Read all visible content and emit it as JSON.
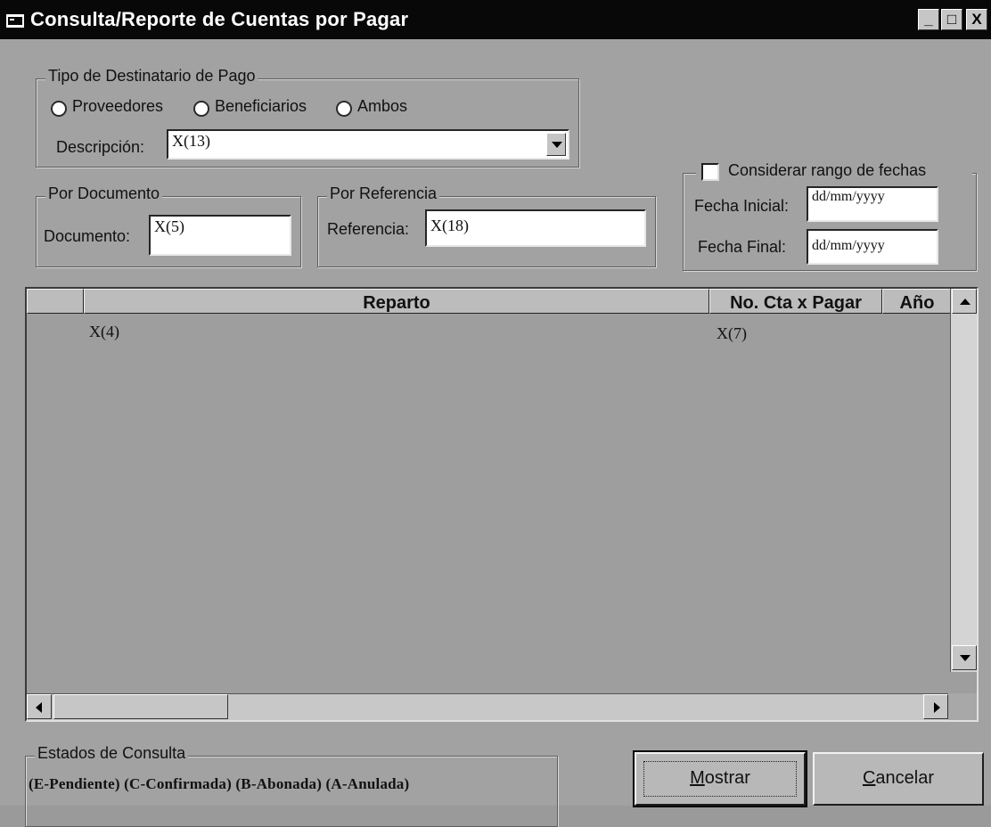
{
  "window": {
    "title": "Consulta/Reporte de Cuentas por Pagar",
    "controls": [
      "_",
      "□",
      "X"
    ]
  },
  "tipo_destinatario": {
    "legend": "Tipo de Destinatario de Pago",
    "options": [
      "Proveedores",
      "Beneficiarios",
      "Ambos"
    ],
    "descripcion_label": "Descripción:",
    "descripcion_value": "X(13)"
  },
  "fechas": {
    "checkbox_label": "Considerar rango de fechas",
    "checked": false,
    "fecha_inicial_label": "Fecha Inicial:",
    "fecha_inicial_value": "dd/mm/yyyy",
    "fecha_final_label": "Fecha Final:",
    "fecha_final_value": "dd/mm/yyyy"
  },
  "por_documento": {
    "legend": "Por Documento",
    "label": "Documento:",
    "value": "X(5)"
  },
  "por_referencia": {
    "legend": "Por Referencia",
    "label": "Referencia:",
    "value": "X(18)"
  },
  "grid": {
    "columns": [
      "",
      "Reparto",
      "No. Cta x Pagar",
      "Año"
    ],
    "rows": [
      {
        "reparto": "X(4)",
        "no_cta": "X(7)",
        "anio": ""
      }
    ]
  },
  "estados": {
    "legend": "Estados de Consulta",
    "text": "(E-Pendiente)  (C-Confirmada)  (B-Abonada)  (A-Anulada)"
  },
  "buttons": {
    "mostrar": {
      "mnemonic": "M",
      "rest": "ostrar"
    },
    "cancelar": {
      "mnemonic": "C",
      "rest": "ancelar"
    }
  },
  "icons": {
    "app": "app-window-icon",
    "dropdown": "chevron-down-icon",
    "minimize": "minimize-icon",
    "maximize": "maximize-icon",
    "close": "close-icon"
  }
}
